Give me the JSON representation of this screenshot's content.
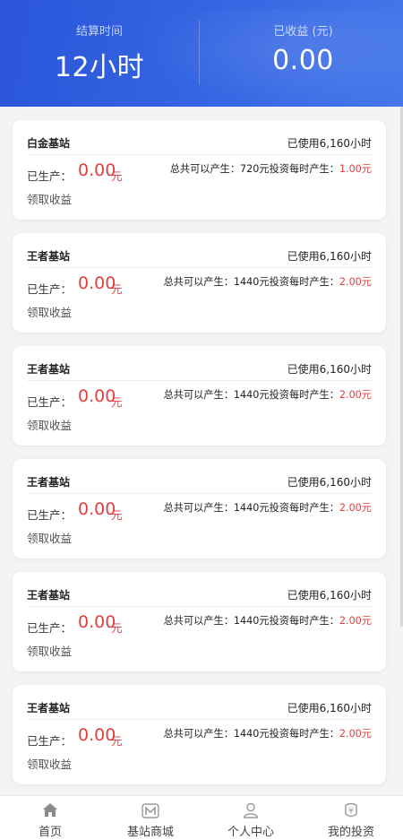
{
  "header": {
    "settle_label": "结算时间",
    "settle_value": "12小时",
    "earned_label": "已收益 (元)",
    "earned_value": "0.00"
  },
  "cards": [
    {
      "name": "白金基站",
      "used": "已使用6,160小时",
      "produced_label": "已生产：",
      "produced_value": "0.00",
      "unit": "元",
      "total_text": "总共可以产生：720元投资每时产生：",
      "rate": "1.00元",
      "claim": "领取收益"
    },
    {
      "name": "王者基站",
      "used": "已使用6,160小时",
      "produced_label": "已生产：",
      "produced_value": "0.00",
      "unit": "元",
      "total_text": "总共可以产生：1440元投资每时产生：",
      "rate": "2.00元",
      "claim": "领取收益"
    },
    {
      "name": "王者基站",
      "used": "已使用6,160小时",
      "produced_label": "已生产：",
      "produced_value": "0.00",
      "unit": "元",
      "total_text": "总共可以产生：1440元投资每时产生：",
      "rate": "2.00元",
      "claim": "领取收益"
    },
    {
      "name": "王者基站",
      "used": "已使用6,160小时",
      "produced_label": "已生产：",
      "produced_value": "0.00",
      "unit": "元",
      "total_text": "总共可以产生：1440元投资每时产生：",
      "rate": "2.00元",
      "claim": "领取收益"
    },
    {
      "name": "王者基站",
      "used": "已使用6,160小时",
      "produced_label": "已生产：",
      "produced_value": "0.00",
      "unit": "元",
      "total_text": "总共可以产生：1440元投资每时产生：",
      "rate": "2.00元",
      "claim": "领取收益"
    },
    {
      "name": "王者基站",
      "used": "已使用6,160小时",
      "produced_label": "已生产：",
      "produced_value": "0.00",
      "unit": "元",
      "total_text": "总共可以产生：1440元投资每时产生：",
      "rate": "2.00元",
      "claim": "领取收益"
    }
  ],
  "tabbar": {
    "items": [
      {
        "label": "首页",
        "icon": "home-icon"
      },
      {
        "label": "基站商城",
        "icon": "store-icon"
      },
      {
        "label": "个人中心",
        "icon": "user-icon"
      },
      {
        "label": "我的投资",
        "icon": "investment-icon"
      }
    ]
  },
  "colors": {
    "header_start": "#2a55d9",
    "header_end": "#4577ea",
    "accent_red": "#e33e3e",
    "home_icon_active": "#8a8a8a"
  }
}
